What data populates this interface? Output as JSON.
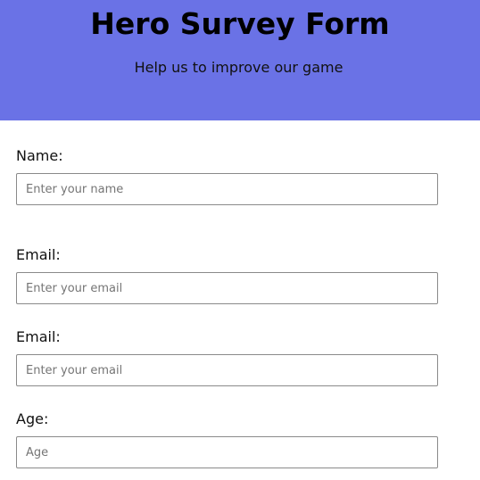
{
  "header": {
    "title": "Hero Survey Form",
    "subtitle": "Help us to improve our game",
    "background_color": "#6a72e6"
  },
  "form": {
    "fields": [
      {
        "label": "Name:",
        "value": "",
        "placeholder": "Enter your name"
      },
      {
        "label": "Email:",
        "value": "",
        "placeholder": "Enter your email"
      },
      {
        "label": "Email:",
        "value": "",
        "placeholder": "Enter your email"
      },
      {
        "label": "Age:",
        "value": "",
        "placeholder": "Age"
      }
    ]
  }
}
